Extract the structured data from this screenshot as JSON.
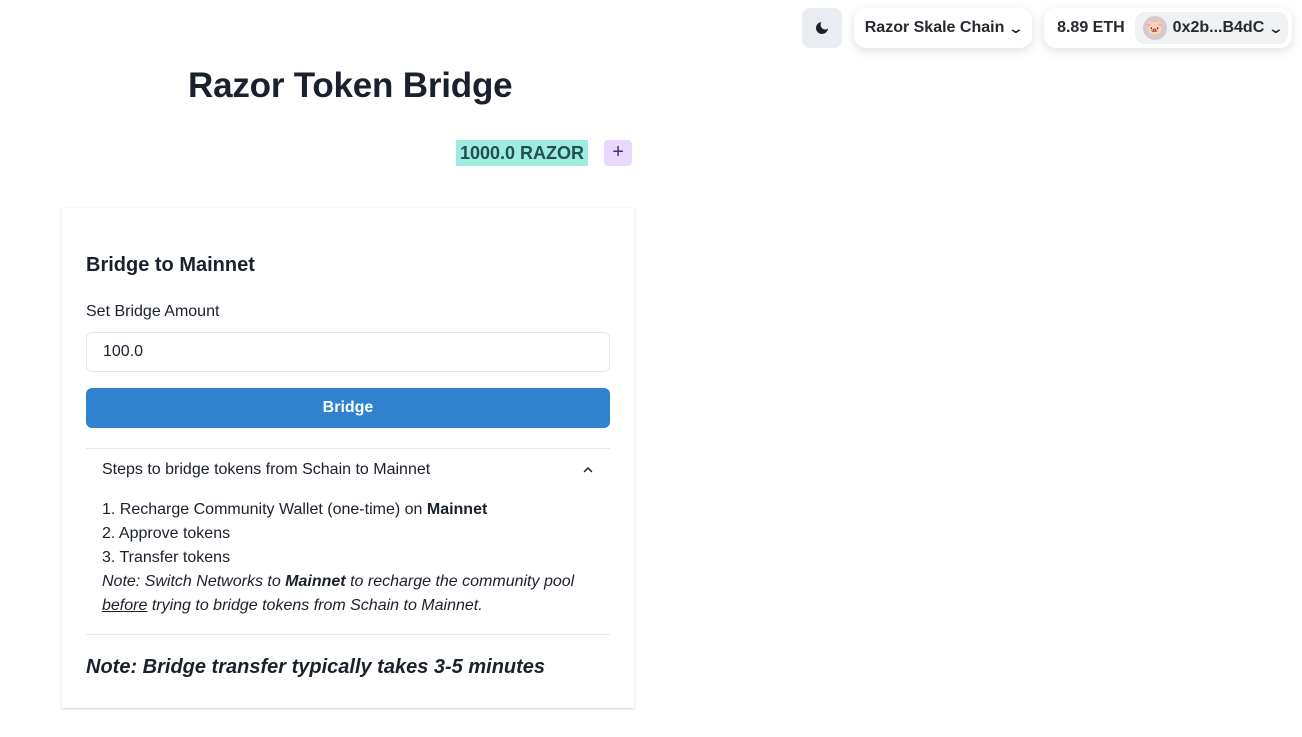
{
  "header": {
    "theme_toggle_icon": "moon-icon",
    "network": {
      "label": "Razor Skale Chain",
      "icon": "chevron-down-icon"
    },
    "account": {
      "balance": "8.89 ETH",
      "address": "0x2b...B4dC",
      "avatar": "🐷",
      "icon": "chevron-down-icon"
    }
  },
  "page": {
    "title": "Razor Token Bridge",
    "token_balance": "1000.0 RAZOR",
    "add_token_label": "+"
  },
  "bridge_card": {
    "title": "Bridge to Mainnet",
    "amount_label": "Set Bridge Amount",
    "amount_value": "100.0",
    "bridge_button": "Bridge",
    "accordion": {
      "header": "Steps to bridge tokens from Schain to Mainnet",
      "icon": "chevron-up-icon",
      "step1_prefix": "1. Recharge Community Wallet (one-time) on ",
      "step1_bold": "Mainnet",
      "step2": "2. Approve tokens",
      "step3": "3. Transfer tokens",
      "note_prefix": "Note: Switch Networks to ",
      "note_bold": "Mainnet",
      "note_middle": " to recharge the community pool ",
      "note_underline": "before",
      "note_suffix": " trying to bridge tokens from Schain to Mainnet."
    },
    "bottom_note": "Note: Bridge transfer typically takes 3-5 minutes"
  }
}
